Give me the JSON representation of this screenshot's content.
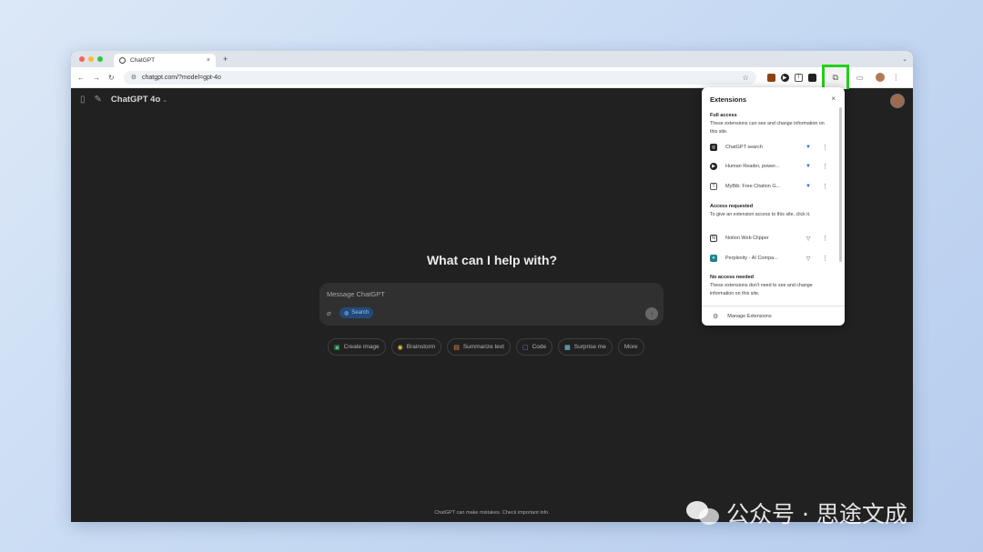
{
  "browser": {
    "tab_title": "ChatGPT",
    "tab_close": "×",
    "new_tab": "+",
    "tab_menu": "⌄",
    "url": "chatgpt.com/?model=gpt-4o"
  },
  "app": {
    "model_name": "ChatGPT 4o",
    "hero_title": "What can I help with?",
    "composer": {
      "placeholder": "Message ChatGPT",
      "search_label": "Search"
    },
    "chips": [
      {
        "label": "Create image",
        "icon": "image-icon",
        "color": "#4ec27a"
      },
      {
        "label": "Brainstorm",
        "icon": "bulb-icon",
        "color": "#e2c541"
      },
      {
        "label": "Summarize text",
        "icon": "doc-icon",
        "color": "#e88a3b"
      },
      {
        "label": "Code",
        "icon": "code-icon",
        "color": "#6c71ff"
      },
      {
        "label": "Surprise me",
        "icon": "gift-icon",
        "color": "#76d0eb"
      },
      {
        "label": "More"
      }
    ],
    "footer_note": "ChatGPT can make mistakes. Check important info."
  },
  "extensions_popup": {
    "title": "Extensions",
    "close": "×",
    "full_access": {
      "title": "Full access",
      "desc": "These extensions can see and change information on this site.",
      "items": [
        {
          "name": "ChatGPT search",
          "pinned": true
        },
        {
          "name": "Human Reader, power...",
          "pinned": true
        },
        {
          "name": "MyBib: Free Citation G...",
          "pinned": true
        }
      ]
    },
    "access_requested": {
      "title": "Access requested",
      "desc": "To give an extension access to this site, click it.",
      "items": [
        {
          "name": "Notion Web Clipper",
          "pinned": false
        },
        {
          "name": "Perplexity - AI Compa...",
          "pinned": false
        }
      ]
    },
    "no_access": {
      "title": "No access needed",
      "desc": "These extensions don't need to see and change information on this site."
    },
    "manage": "Manage Extensions"
  },
  "watermark": "公众号 · 思途文成",
  "colors": {
    "highlight": "#22d01a",
    "app_bg": "#212121",
    "pin_blue": "#1a73e8"
  }
}
